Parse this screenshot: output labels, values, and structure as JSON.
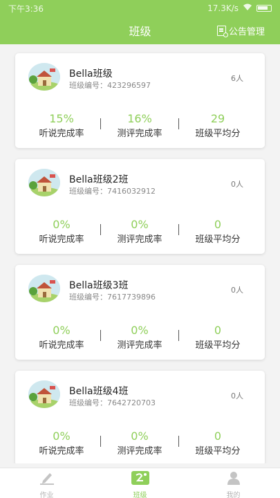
{
  "status_bar": {
    "time": "下午3:36",
    "speed": "17.3K/s"
  },
  "header": {
    "title": "班级",
    "notice_label": "公告管理"
  },
  "cards": [
    {
      "name": "Bella班级",
      "id_label": "班级编号：423296597",
      "count": "6人",
      "stats": [
        {
          "value": "15%",
          "label": "听说完成率"
        },
        {
          "value": "16%",
          "label": "测评完成率"
        },
        {
          "value": "29",
          "label": "班级平均分"
        }
      ]
    },
    {
      "name": "Bella班级2班",
      "id_label": "班级编号：7416032912",
      "count": "0人",
      "stats": [
        {
          "value": "0%",
          "label": "听说完成率"
        },
        {
          "value": "0%",
          "label": "测评完成率"
        },
        {
          "value": "0",
          "label": "班级平均分"
        }
      ]
    },
    {
      "name": "Bella班级3班",
      "id_label": "班级编号：7617739896",
      "count": "0人",
      "stats": [
        {
          "value": "0%",
          "label": "听说完成率"
        },
        {
          "value": "0%",
          "label": "测评完成率"
        },
        {
          "value": "0",
          "label": "班级平均分"
        }
      ]
    },
    {
      "name": "Bella班级4班",
      "id_label": "班级编号：7642720703",
      "count": "0人",
      "stats": [
        {
          "value": "0%",
          "label": "听说完成率"
        },
        {
          "value": "0%",
          "label": "测评完成率"
        },
        {
          "value": "0",
          "label": "班级平均分"
        }
      ]
    }
  ],
  "tabs": [
    {
      "label": "作业",
      "icon": "homework-icon",
      "active": false
    },
    {
      "label": "班级",
      "icon": "class-icon",
      "active": true
    },
    {
      "label": "我的",
      "icon": "profile-icon",
      "active": false
    }
  ],
  "colors": {
    "accent": "#8fcf5a",
    "background": "#f3f3f3"
  }
}
